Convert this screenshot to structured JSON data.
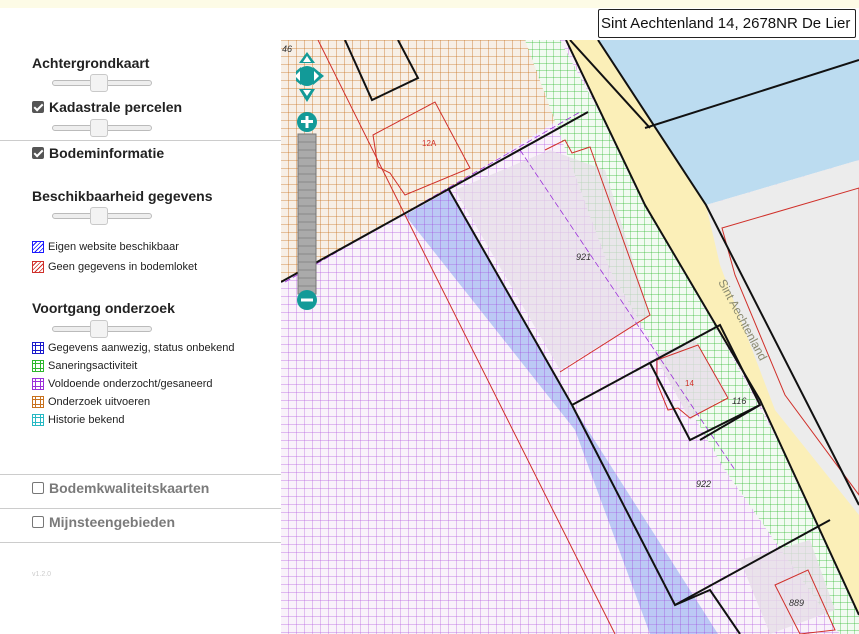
{
  "search": {
    "value": "Sint Aechtenland 14, 2678NR De Lier"
  },
  "panel": {
    "achtergrondkaart": "Achtergrondkaart",
    "kadastrale_percelen": "Kadastrale percelen",
    "bodeminformatie": "Bodeminformatie",
    "beschikbaarheid": "Beschikbaarheid gegevens",
    "beschikbaarheid_legend": [
      {
        "label": "Eigen website beschikbaar",
        "color": "#1a1aff"
      },
      {
        "label": "Geen gegevens in bodemloket",
        "color": "#d0302a"
      }
    ],
    "voortgang": "Voortgang onderzoek",
    "voortgang_legend": [
      {
        "label": "Gegevens aanwezig, status onbekend",
        "color": "#1a1acc"
      },
      {
        "label": "Saneringsactiviteit",
        "color": "#2db82d"
      },
      {
        "label": "Voldoende onderzocht/gesaneerd",
        "color": "#9b30d9"
      },
      {
        "label": "Onderzoek uitvoeren",
        "color": "#c8711e"
      },
      {
        "label": "Historie bekend",
        "color": "#27b9c4"
      }
    ],
    "bodemkwaliteitskaarten": "Bodemkwaliteitskaarten",
    "mijnsteengebieden": "Mijnsteengebieden",
    "version": "v1.2.0"
  },
  "map": {
    "labels": {
      "p46": "46",
      "p12a": "12A",
      "p921": "921",
      "p14": "14",
      "p116": "116",
      "p922": "922",
      "p889": "889"
    },
    "street": "Sint Aechtenland",
    "colors": {
      "orange": "#c8711e",
      "purple": "#9b30d9",
      "green": "#2db82d",
      "red": "#d0302a",
      "blue": "#1a1aff",
      "water": "#bcdcf0",
      "road": "#fbefb8"
    }
  },
  "zoom": {
    "plus_icon": "zoom-in-icon",
    "minus_icon": "zoom-out-icon",
    "pan_icon": "pan-arrows-icon"
  }
}
